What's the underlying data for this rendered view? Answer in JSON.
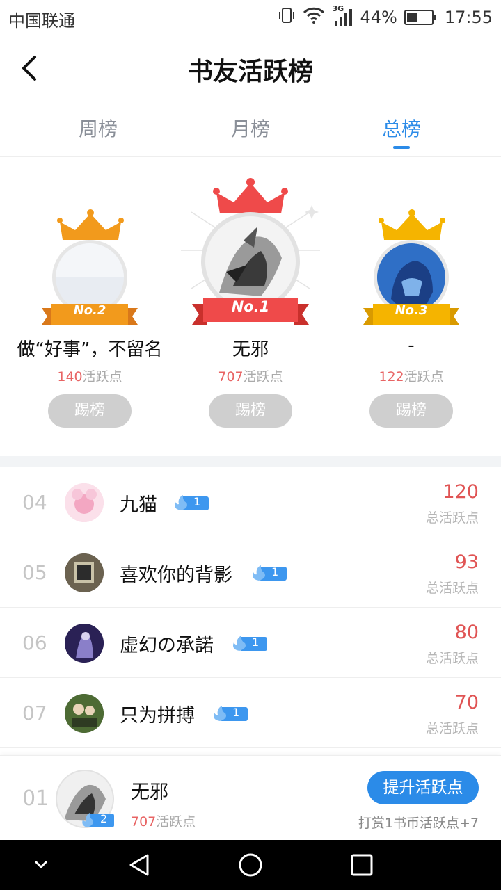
{
  "status_bar": {
    "carrier": "中国联通",
    "network": "3G",
    "battery": "44%",
    "battery_level": 0.44,
    "time": "17:55"
  },
  "header": {
    "title": "书友活跃榜",
    "back_icon": "chevron-left-icon"
  },
  "tabs": [
    {
      "label": "周榜",
      "active": false
    },
    {
      "label": "月榜",
      "active": false
    },
    {
      "label": "总榜",
      "active": true
    }
  ],
  "podium": {
    "kick_label": "踢榜",
    "points_suffix": "活跃点",
    "first": {
      "rank_label": "No.1",
      "name": "无邪",
      "points": "707"
    },
    "second": {
      "rank_label": "No.2",
      "name": "做“好事”，不留名",
      "points": "140"
    },
    "third": {
      "rank_label": "No.3",
      "name": "-",
      "points": "122"
    }
  },
  "ranking": {
    "score_label": "总活跃点",
    "rows": [
      {
        "rank": "04",
        "name": "九猫",
        "level": "1",
        "score": "120"
      },
      {
        "rank": "05",
        "name": "喜欢你的背影",
        "level": "1",
        "score": "93"
      },
      {
        "rank": "06",
        "name": "虚幻の承諾",
        "level": "1",
        "score": "80"
      },
      {
        "rank": "07",
        "name": "只为拼搏",
        "level": "1",
        "score": "70"
      }
    ]
  },
  "self": {
    "rank": "01",
    "name": "无邪",
    "level": "2",
    "points": "707",
    "points_suffix": "活跃点",
    "boost_label": "提升活跃点",
    "boost_hint": "打赏1书币活跃点+7"
  },
  "colors": {
    "accent": "#2b8be8",
    "score_red": "#e05454",
    "gold": "#f5b400",
    "first_red": "#ef4a4a",
    "second_orange": "#f29a1c"
  }
}
